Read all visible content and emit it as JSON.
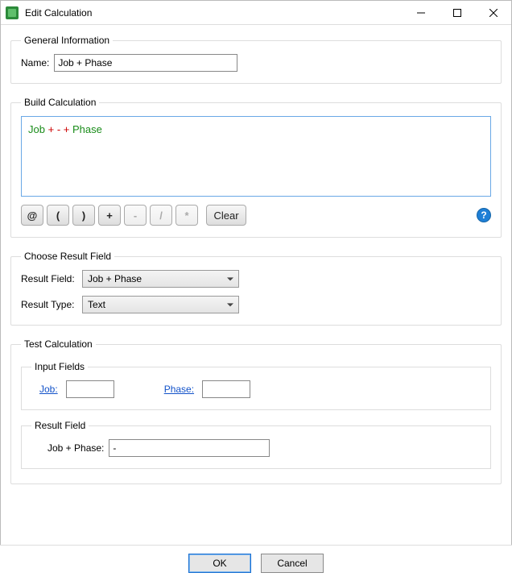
{
  "window": {
    "title": "Edit Calculation"
  },
  "general": {
    "legend": "General Information",
    "name_label": "Name:",
    "name_value": "Job + Phase"
  },
  "build": {
    "legend": "Build Calculation",
    "formula": {
      "field1": "Job",
      "op1": "+",
      "lit": "-",
      "op2": "+",
      "field2": "Phase"
    },
    "buttons": {
      "at": "@",
      "lparen": "(",
      "rparen": ")",
      "plus": "+",
      "minus": "-",
      "div": "/",
      "mul": "*",
      "clear": "Clear"
    },
    "help_char": "?"
  },
  "choose": {
    "legend": "Choose Result Field",
    "result_field_label": "Result Field:",
    "result_field_value": "Job + Phase",
    "result_type_label": "Result Type:",
    "result_type_value": "Text"
  },
  "test": {
    "legend": "Test Calculation",
    "input_fields_legend": "Input Fields",
    "job_label": "Job:",
    "job_value": "",
    "phase_label": "Phase:",
    "phase_value": "",
    "result_field_legend": "Result Field",
    "result_label": "Job + Phase:",
    "result_value": "-"
  },
  "footer": {
    "ok": "OK",
    "cancel": "Cancel"
  }
}
